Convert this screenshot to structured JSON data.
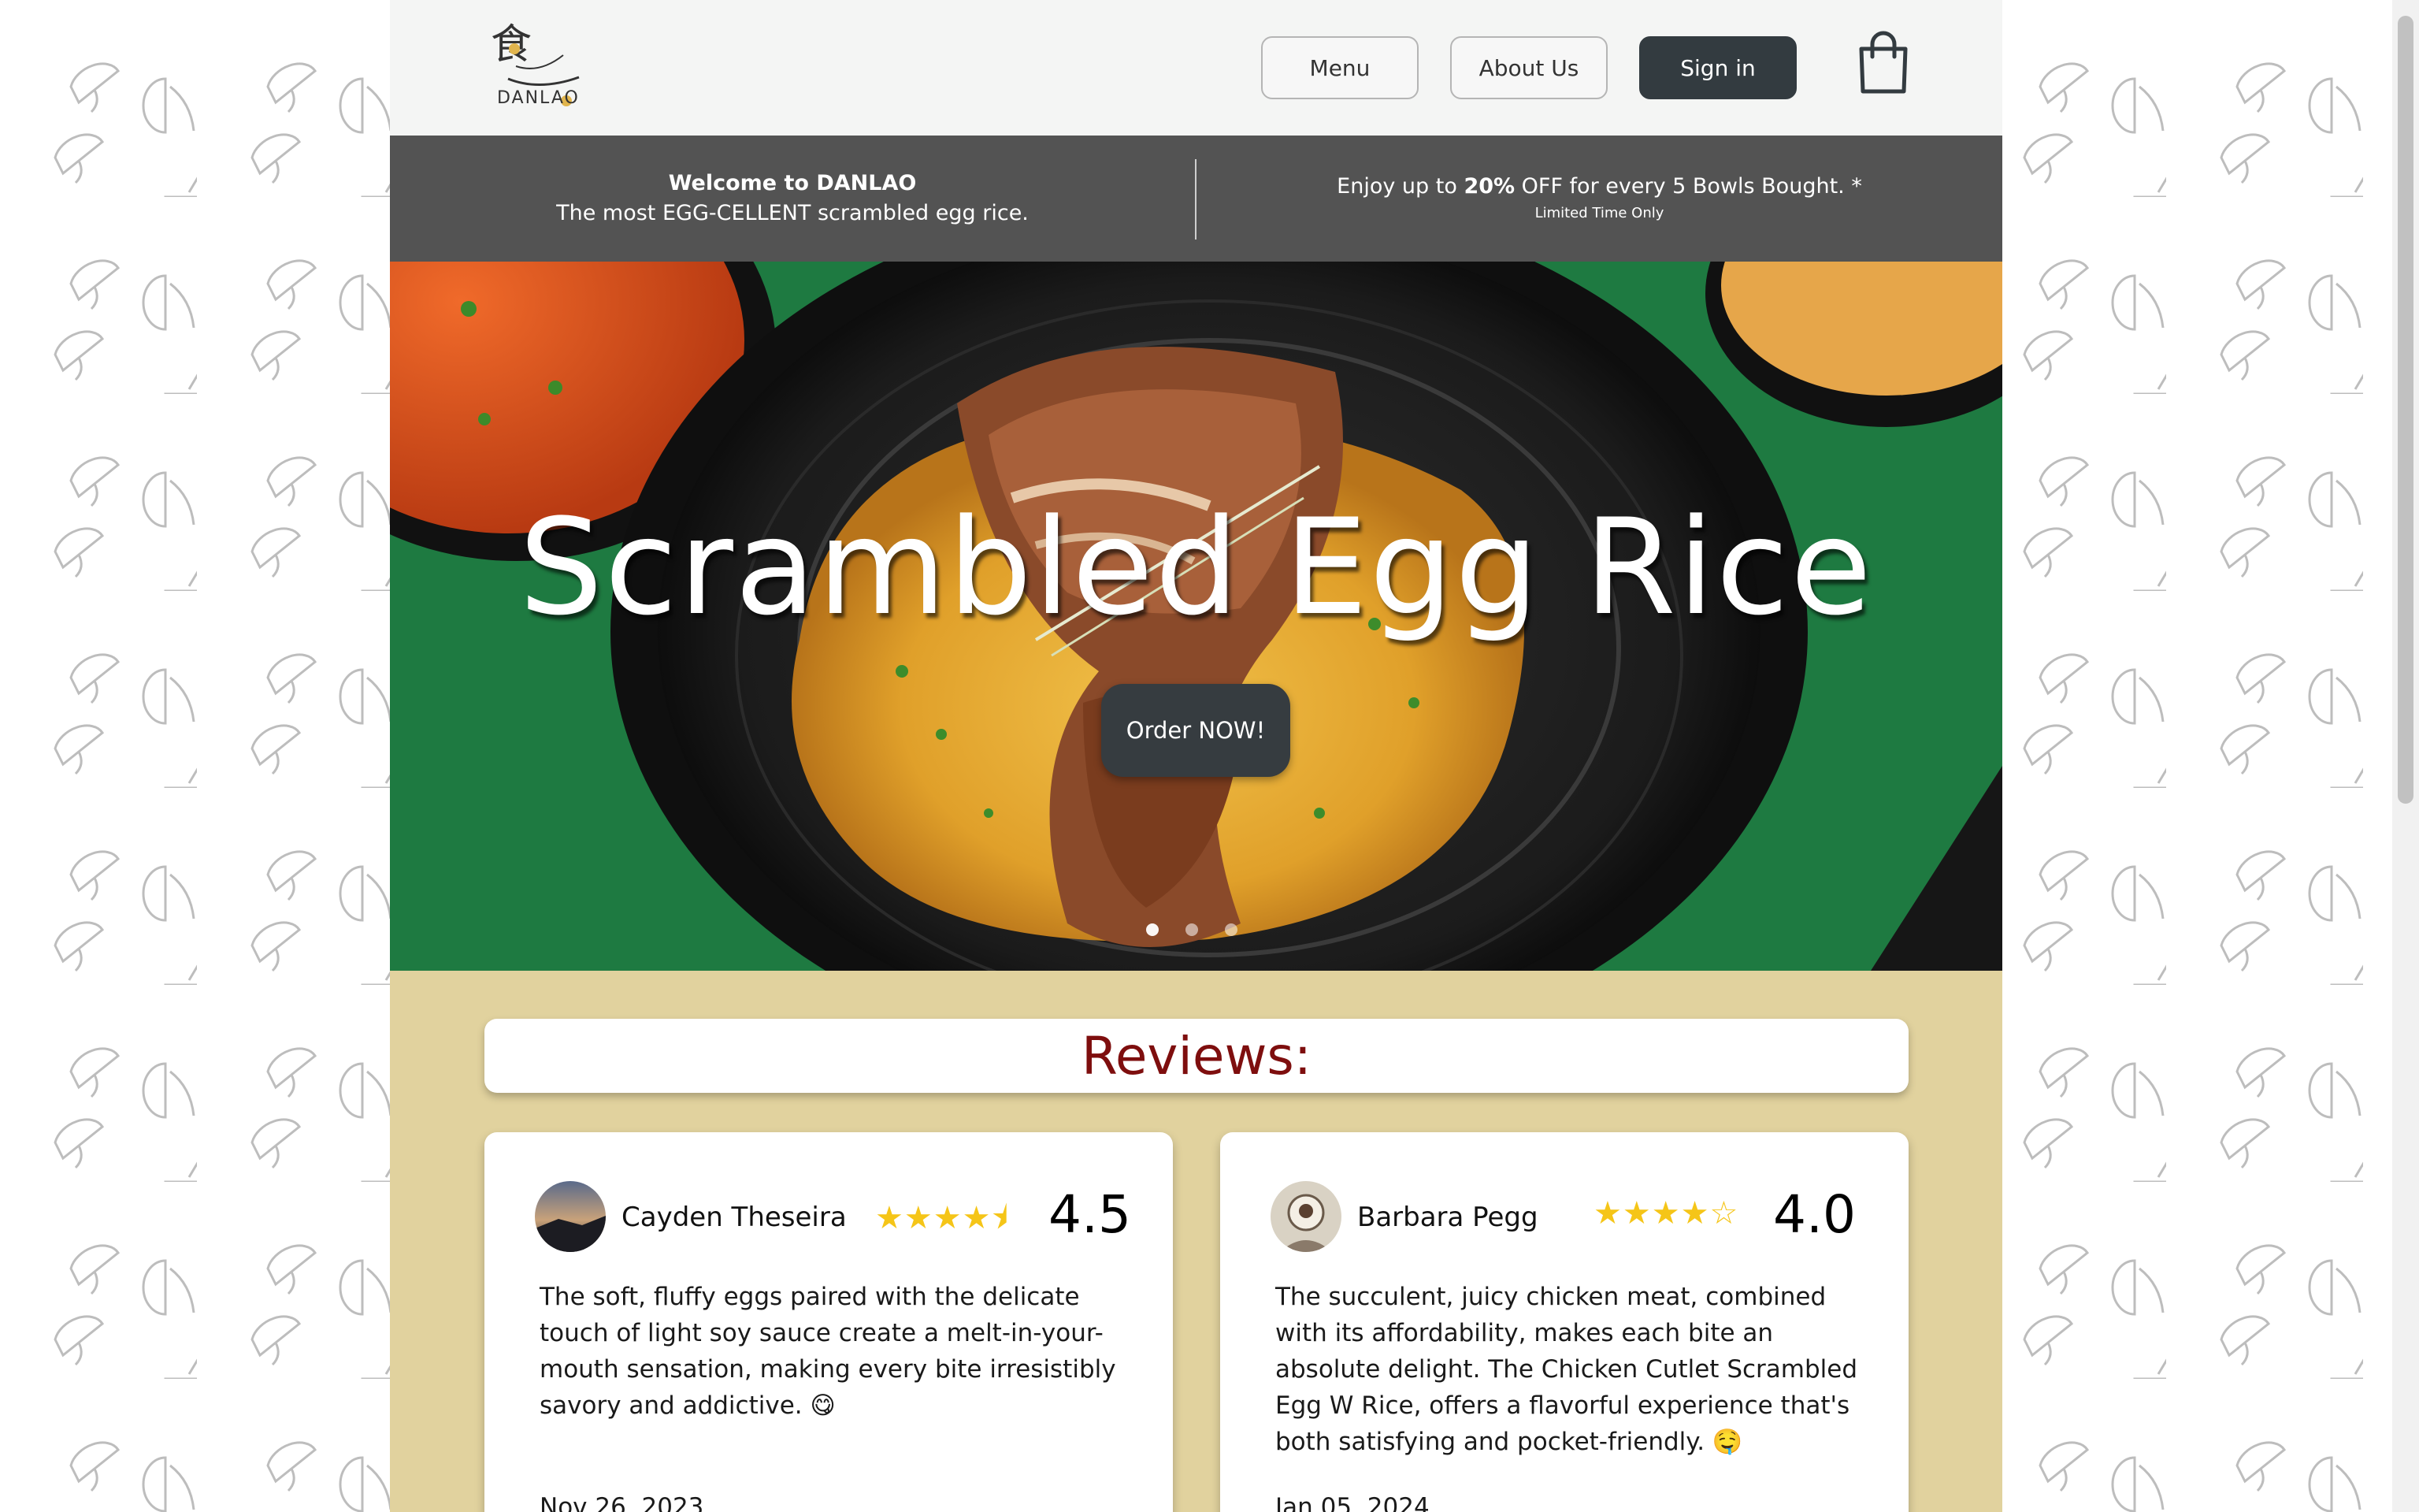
{
  "brand": {
    "name": "DANLAO",
    "logo_alt": "DANLAO"
  },
  "nav": {
    "menu_label": "Menu",
    "about_label": "About Us",
    "signin_label": "Sign in",
    "cart_icon": "shopping-bag-icon"
  },
  "promo": {
    "welcome_title": "Welcome to DANLAO",
    "welcome_sub": "The most EGG-CELLENT scrambled egg rice.",
    "offer_pre": "Enjoy up to ",
    "offer_bold": "20%",
    "offer_post": " OFF for every 5 Bowls Bought. *",
    "offer_note": "Limited Time Only"
  },
  "hero": {
    "title": "Scrambled Egg Rice",
    "cta_label": "Order NOW!",
    "slides": 3,
    "active_slide": 1
  },
  "reviews": {
    "heading": "Reviews:",
    "items": [
      {
        "name": "Cayden Theseira",
        "stars": "★★★★⯨",
        "rating": "4.5",
        "text": "The soft, fluffy eggs paired with the delicate touch of light soy sauce create a melt-in-your-mouth sensation, making every bite irresistibly savory and addictive. 😋",
        "date": "Nov 26, 2023"
      },
      {
        "name": "Barbara Pegg",
        "stars": "★★★★☆",
        "rating": "4.0",
        "text": "The succulent, juicy chicken meat, combined with its affordability, makes each bite an absolute delight. The Chicken Cutlet Scrambled Egg W Rice, offers a flavorful experience that's both satisfying and pocket-friendly. 🤤",
        "date": "Jan 05, 2024"
      }
    ]
  },
  "colors": {
    "header_bg": "#f4f5f4",
    "promo_bg": "#535353",
    "page_bg": "#e1d29e",
    "accent_dark": "#333b40",
    "reviews_heading": "#7e0e0e",
    "star": "#f5c518"
  }
}
